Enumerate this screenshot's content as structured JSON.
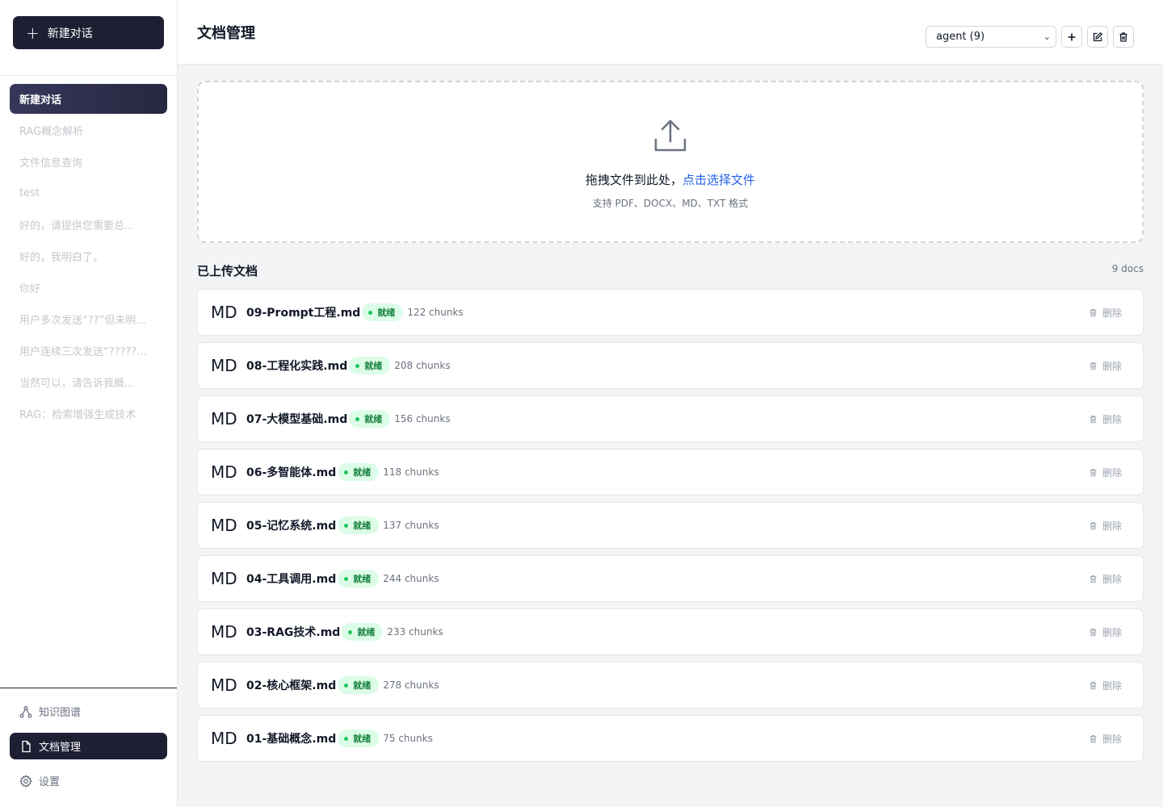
{
  "sidebar": {
    "new_chat_label": "新建对话",
    "conversations": [
      "新建对话",
      "RAG概念解析",
      "文件信息查询",
      "test",
      "好的，请提供您需要总...",
      "好的，我明白了。",
      "你好",
      "用户多次发送“??”但未明...",
      "用户连续三次发送“?????...",
      "当然可以，请告诉我概...",
      "RAG：检索增强生成技术"
    ],
    "nav": {
      "knowledge_graph": "知识图谱",
      "documents": "文档管理",
      "settings": "设置"
    }
  },
  "header": {
    "title": "文档管理",
    "kb_selected": "agent (9)"
  },
  "upload": {
    "text": "拖拽文件到此处，",
    "link": "点击选择文件",
    "hint": "支持 PDF、DOCX、MD、TXT 格式"
  },
  "docs": {
    "title": "已上传文档",
    "count": "9 docs",
    "status_label": "就绪",
    "delete_label": "删除",
    "items": [
      {
        "type": "MD",
        "name": "09-Prompt工程.md",
        "chunks": "122 chunks"
      },
      {
        "type": "MD",
        "name": "08-工程化实践.md",
        "chunks": "208 chunks"
      },
      {
        "type": "MD",
        "name": "07-大模型基础.md",
        "chunks": "156 chunks"
      },
      {
        "type": "MD",
        "name": "06-多智能体.md",
        "chunks": "118 chunks"
      },
      {
        "type": "MD",
        "name": "05-记忆系统.md",
        "chunks": "137 chunks"
      },
      {
        "type": "MD",
        "name": "04-工具调用.md",
        "chunks": "244 chunks"
      },
      {
        "type": "MD",
        "name": "03-RAG技术.md",
        "chunks": "233 chunks"
      },
      {
        "type": "MD",
        "name": "02-核心框架.md",
        "chunks": "278 chunks"
      },
      {
        "type": "MD",
        "name": "01-基础概念.md",
        "chunks": "75 chunks"
      }
    ]
  },
  "colors": {
    "primary_dark": "#1e1f33",
    "link": "#2563eb",
    "status_bg": "#dcfce7",
    "status_fg": "#15803d"
  },
  "icons": {
    "new_chat": "plus-icon",
    "upload": "upload-icon",
    "knowledge_graph": "graph-icon",
    "documents": "file-icon",
    "settings": "gear-icon",
    "delete": "trash-icon",
    "add": "plus-icon",
    "edit": "edit-icon"
  }
}
